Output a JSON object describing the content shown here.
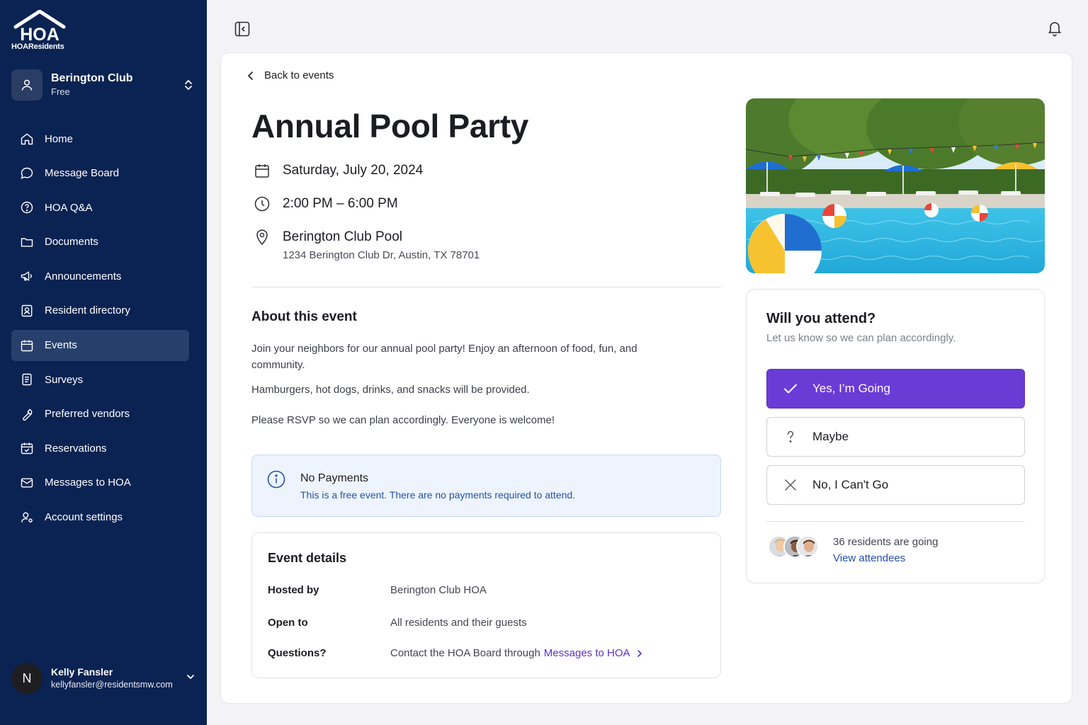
{
  "brand": {
    "logo_text": "HOA",
    "logo_sub": "HOAResidents"
  },
  "org": {
    "name": "Berington Club",
    "plan": "Free"
  },
  "nav": [
    {
      "label": "Home",
      "icon": "home-icon"
    },
    {
      "label": "Message Board",
      "icon": "chat-bubble-icon"
    },
    {
      "label": "HOA Q&A",
      "icon": "question-circle-icon"
    },
    {
      "label": "Documents",
      "icon": "folder-icon"
    },
    {
      "label": "Announcements",
      "icon": "megaphone-icon"
    },
    {
      "label": "Resident directory",
      "icon": "contact-card-icon"
    },
    {
      "label": "Events",
      "icon": "calendar-icon",
      "active": true
    },
    {
      "label": "Surveys",
      "icon": "clipboard-list-icon"
    },
    {
      "label": "Preferred vendors",
      "icon": "wrench-icon"
    },
    {
      "label": "Reservations",
      "icon": "calendar-check-icon"
    },
    {
      "label": "Messages to HOA",
      "icon": "envelope-icon"
    },
    {
      "label": "Account settings",
      "icon": "user-settings-icon"
    }
  ],
  "user": {
    "initial": "N",
    "name": "Kelly Fansler",
    "email": "kellyfansler@residentsmw.com"
  },
  "event": {
    "back_label": "Back to events",
    "title": "Annual Pool Party",
    "date": "Saturday, July 20, 2024",
    "time": "2:00 PM – 6:00 PM",
    "location_name": "Berington Club Pool",
    "location_address": "1234 Berington Club Dr, Austin, TX 78701",
    "about_heading": "About this event",
    "about_paragraphs": [
      "Join your neighbors for our annual pool party! Enjoy an afternoon of food, fun, and community.",
      "Hamburgers, hot dogs, drinks, and snacks will be provided.",
      "Please RSVP so we can plan accordingly. Everyone is welcome!"
    ],
    "notice": {
      "heading": "No Payments",
      "text": "This is a free event. There are no payments required to attend."
    },
    "details": {
      "heading": "Event details",
      "rows": [
        {
          "key": "Hosted by",
          "value": "Berington Club HOA"
        },
        {
          "key": "Open to",
          "value": "All residents and their guests"
        },
        {
          "key": "Questions?",
          "value": "Contact the HOA Board through",
          "link": "Messages to HOA"
        }
      ]
    }
  },
  "rsvp": {
    "heading": "Will you attend?",
    "subtext": "Let us know so we can plan accordingly.",
    "options": [
      {
        "label": "Yes, I’m Going",
        "icon": "check-icon",
        "selected": true
      },
      {
        "label": "Maybe",
        "icon": "question-mark-icon",
        "selected": false
      },
      {
        "label": "No, I Can't Go",
        "icon": "x-icon",
        "selected": false
      }
    ],
    "going_text": "36 residents are going",
    "view_attendees": "View attendees"
  },
  "colors": {
    "sidebar_bg": "#0b2352",
    "accent_purple": "#6b3bd6",
    "link_blue": "#2352a6",
    "notice_bg": "#eef4fd"
  }
}
